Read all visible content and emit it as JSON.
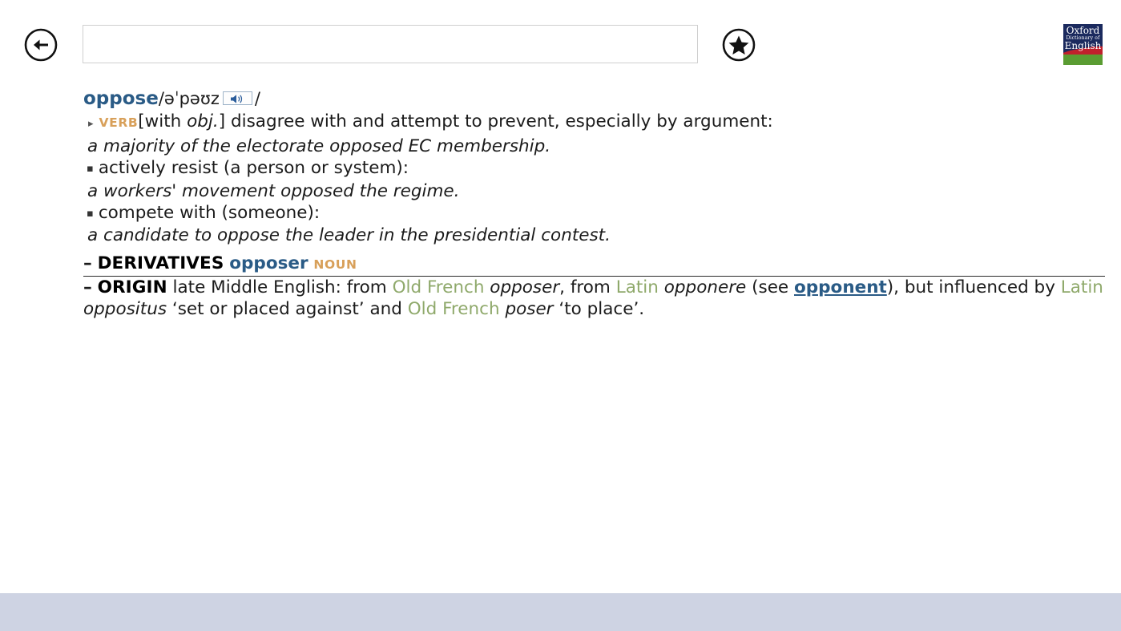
{
  "toolbar": {
    "back_icon": "back-arrow-circle-icon",
    "favorite_icon": "star-circle-icon",
    "search": {
      "value": "",
      "placeholder": ""
    },
    "brand": {
      "line1": "Oxford",
      "line2": "Dictionary of",
      "line3": "English",
      "colors": {
        "navy": "#1b2a5e",
        "red": "#c0202c",
        "green": "#5a9c32"
      }
    }
  },
  "entry": {
    "headword": "oppose",
    "pron_open": "/",
    "pronunciation": "əˈpəʊz",
    "pron_close": "/",
    "audio_icon": "speaker-icon",
    "triangle_bullet": "▸",
    "square_bullet": "▪",
    "part_of_speech": "VERB",
    "grammar_open": "[with ",
    "grammar_italic": "obj.",
    "grammar_close": "]",
    "senses": [
      {
        "definition": "disagree with and attempt to prevent, especially by argument:",
        "example": "a majority of the electorate opposed EC membership."
      },
      {
        "definition": "actively resist (a person or system):",
        "example": "a workers' movement opposed the regime."
      },
      {
        "definition": "compete with (someone):",
        "example": "a candidate to oppose the leader in the presidential contest."
      }
    ],
    "derivatives": {
      "dash": "–",
      "label": "DERIVATIVES",
      "word": "opposer",
      "pos": "NOUN"
    },
    "origin": {
      "dash": "–",
      "label": "ORIGIN",
      "t1": " late Middle English: from ",
      "lang1": "Old French",
      "it1": "opposer",
      "t2": ", from ",
      "lang2": "Latin",
      "it2": "opponere",
      "t3": " (see ",
      "xref": "opponent",
      "t4": "), but influenced by ",
      "lang3": "Latin",
      "it3": "oppositus",
      "t5": " ‘set or placed against’ and ",
      "lang4": "Old French",
      "it4": "poser",
      "t6": " ‘to place’."
    }
  },
  "appbar": {
    "color": "#ced3e3"
  }
}
